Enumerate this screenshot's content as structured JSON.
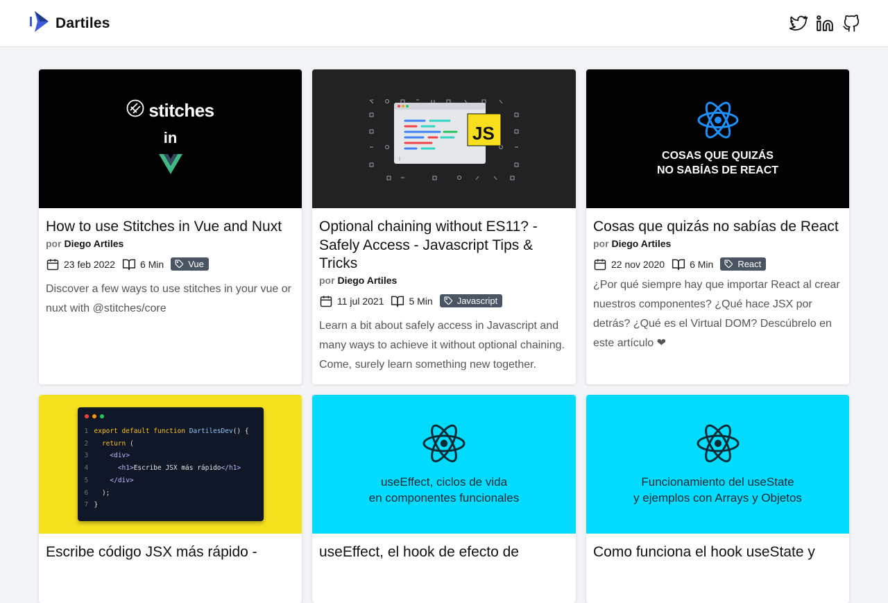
{
  "header": {
    "brand_name": "Dartiles",
    "social_icons": [
      "twitter-icon",
      "linkedin-icon",
      "github-icon"
    ]
  },
  "labels": {
    "by": "por"
  },
  "cards": [
    {
      "title": "How to use Stitches in Vue and Nuxt",
      "author": "Diego Artiles",
      "date": "23 feb 2022",
      "read_time": "6 Min",
      "tag": "Vue",
      "excerpt": "Discover a few ways to use stitches in your vue or nuxt with @stitches/core",
      "cover": {
        "logo_text": "stitches",
        "in_text": "in"
      }
    },
    {
      "title": "Optional chaining without ES11? - Safely Access - Javascript Tips & Tricks",
      "author": "Diego Artiles",
      "date": "11 jul 2021",
      "read_time": "5 Min",
      "tag": "Javascript",
      "excerpt": "Learn a bit about safely access in Javascript and many ways to achieve it without optional chaining. Come, surely learn something new together.",
      "cover": {
        "badge_text": "JS"
      }
    },
    {
      "title": "Cosas que quizás no sabías de React",
      "author": "Diego Artiles",
      "date": "22 nov 2020",
      "read_time": "6 Min",
      "tag": "React",
      "excerpt": "¿Por qué siempre hay que importar React al crear nuestros componentes? ¿Qué hace JSX por detrás? ¿Qué es el Virtual DOM? Descúbrelo en este artículo ❤",
      "cover": {
        "line1": "COSAS QUE QUIZÁS",
        "line2": "NO SABÍAS DE REACT"
      }
    },
    {
      "title": "Escribe código JSX más rápido -",
      "cover": {
        "code": [
          {
            "n": "1",
            "parts": [
              [
                "kw",
                "export default function "
              ],
              [
                "fn",
                "DartilesDev"
              ],
              [
                "",
                "() {"
              ]
            ]
          },
          {
            "n": "2",
            "parts": [
              [
                "kw",
                "  return "
              ],
              [
                "",
                "("
              ]
            ]
          },
          {
            "n": "3",
            "parts": [
              [
                "tg",
                "    <div>"
              ]
            ]
          },
          {
            "n": "4",
            "parts": [
              [
                "tg",
                "      <h1>"
              ],
              [
                "",
                "Escribe JSX más rápido"
              ],
              [
                "tg",
                "</h1>"
              ]
            ]
          },
          {
            "n": "5",
            "parts": [
              [
                "tg",
                "    </div>"
              ]
            ]
          },
          {
            "n": "6",
            "parts": [
              [
                "",
                "  );"
              ]
            ]
          },
          {
            "n": "7",
            "parts": [
              [
                "",
                "}"
              ]
            ]
          }
        ]
      }
    },
    {
      "title": "useEffect, el hook de efecto de",
      "cover": {
        "line1": "useEffect, ciclos de vida",
        "line2": "en componentes funcionales"
      }
    },
    {
      "title": "Como funciona el hook useState y",
      "cover": {
        "line1": "Funcionamiento del useState",
        "line2": "y ejemplos con Arrays y Objetos"
      }
    }
  ],
  "colors": {
    "brand_blue": "#3b5bdb",
    "tag_bg": "#4a5564",
    "react_blue": "#1e90ff",
    "jsx_yellow": "#f5e21e",
    "cyan": "#00dbff"
  }
}
